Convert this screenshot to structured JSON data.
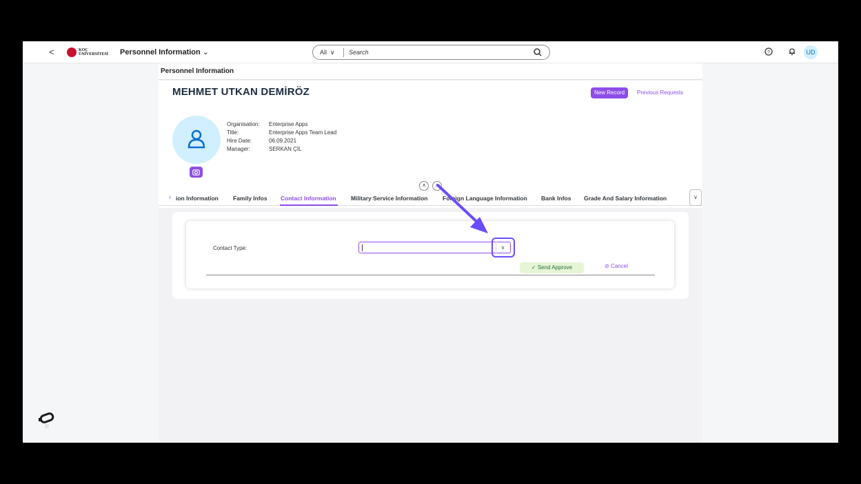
{
  "shell": {
    "back_label": "<",
    "logo_text_1": "KOÇ",
    "logo_text_2": "ÜNİVERSİTESİ",
    "app_title": "Personnel Information",
    "search_scope": "All",
    "search_placeholder": "Search",
    "user_initials": "UD"
  },
  "page": {
    "title": "Personnel Information"
  },
  "employee": {
    "name": "MEHMET UTKAN DEMİRÖZ",
    "fields": [
      {
        "label": "Organisation:",
        "value": "Enterprise Apps"
      },
      {
        "label": "Title:",
        "value": "Enterprise Apps Team Lead"
      },
      {
        "label": "Hire Date:",
        "value": "06.09.2021"
      },
      {
        "label": "Manager:",
        "value": "SERKAN ÇİL"
      }
    ]
  },
  "actions": {
    "new_record": "New Record",
    "previous_requests": "Previous Requests"
  },
  "tabs": [
    {
      "label": "ion Information",
      "active": false
    },
    {
      "label": "Family Infos",
      "active": false
    },
    {
      "label": "Contact Information",
      "active": true
    },
    {
      "label": "Military Service Information",
      "active": false
    },
    {
      "label": "Foreign Language Information",
      "active": false
    },
    {
      "label": "Bank Infos",
      "active": false
    },
    {
      "label": "Grade And Salary Information",
      "active": false
    }
  ],
  "form": {
    "contact_type_label": "Contact Type:",
    "contact_type_value": "",
    "send_approve": "Send Approve",
    "cancel": "Cancel"
  },
  "colors": {
    "accent": "#8d4de8",
    "annotation": "#6b4bff",
    "positive_bg": "#e5f5d5",
    "positive_text": "#256f3a"
  }
}
